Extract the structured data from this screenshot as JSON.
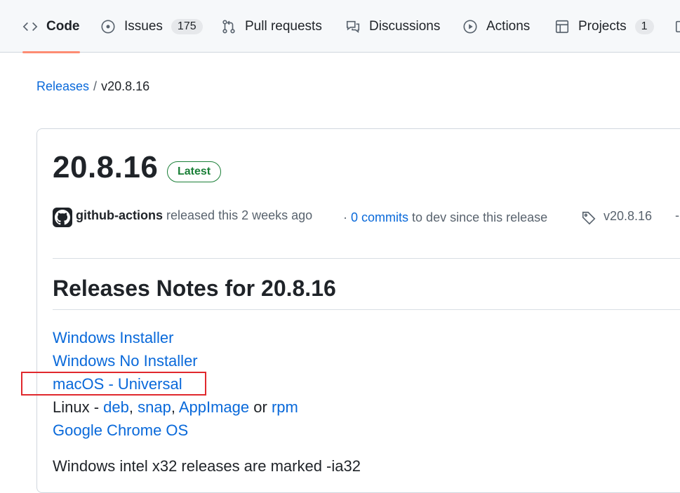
{
  "nav": {
    "tabs": [
      {
        "label": "Code",
        "icon": "code-icon"
      },
      {
        "label": "Issues",
        "icon": "issue-icon",
        "count": "175"
      },
      {
        "label": "Pull requests",
        "icon": "pull-request-icon"
      },
      {
        "label": "Discussions",
        "icon": "discussions-icon"
      },
      {
        "label": "Actions",
        "icon": "play-icon"
      },
      {
        "label": "Projects",
        "icon": "table-icon",
        "count": "1"
      }
    ]
  },
  "breadcrumb": {
    "parent": "Releases",
    "separator": "/",
    "current": "v20.8.16"
  },
  "release": {
    "title": "20.8.16",
    "badge": "Latest",
    "author": "github-actions",
    "released_text": "released this 2 weeks ago",
    "dot": "·",
    "commits_link": "0 commits",
    "commits_suffix": "to dev since this release",
    "tag": "v20.8.16",
    "overflow": "-"
  },
  "notes": {
    "heading": "Releases Notes for 20.8.16",
    "links": {
      "windows_installer": "Windows Installer",
      "windows_no_installer": "Windows No Installer",
      "macos_universal": "macOS - Universal",
      "linux_prefix": "Linux - ",
      "linux_deb": "deb",
      "linux_comma1": ", ",
      "linux_snap": "snap",
      "linux_comma2": ", ",
      "linux_appimage": "AppImage",
      "linux_or": " or ",
      "linux_rpm": "rpm",
      "chrome_os": "Google Chrome OS"
    },
    "footnote": "Windows intel x32 releases are marked -ia32"
  },
  "colors": {
    "accent_link": "#0969da",
    "selected_underline": "#fd8c73",
    "latest_green": "#1a7f37",
    "highlight_red": "#e0282d"
  }
}
